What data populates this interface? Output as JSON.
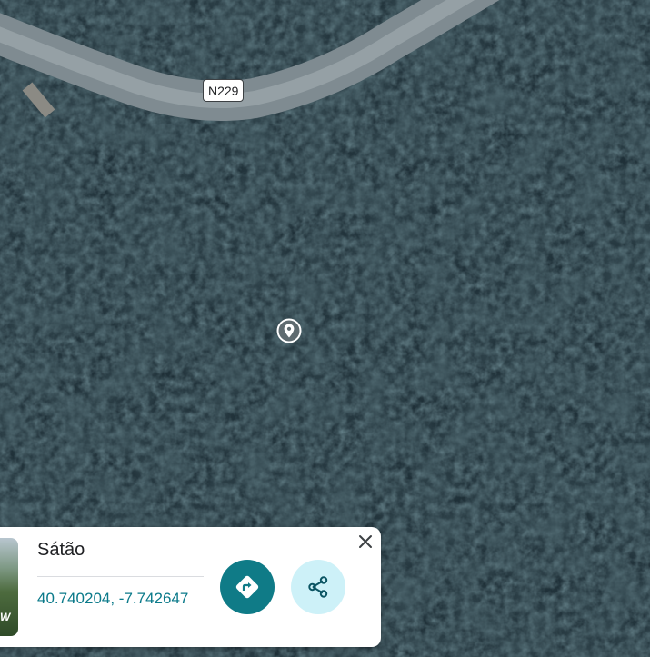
{
  "map": {
    "road_label": "N229",
    "style": "satellite",
    "colors": {
      "forest_dark": "#17262d",
      "forest_mid": "#2a3f46",
      "road": "#8e9aa0",
      "accent": "#0f7b87",
      "share_bg": "#cdf1f8"
    }
  },
  "marker": {
    "icon": "location-pin-icon"
  },
  "place_card": {
    "name": "Sátão",
    "coordinates": "40.740204, -7.742647",
    "thumbnail_label": "W",
    "buttons": {
      "directions_icon": "directions-icon",
      "share_icon": "share-icon",
      "close_icon": "close-icon"
    }
  }
}
